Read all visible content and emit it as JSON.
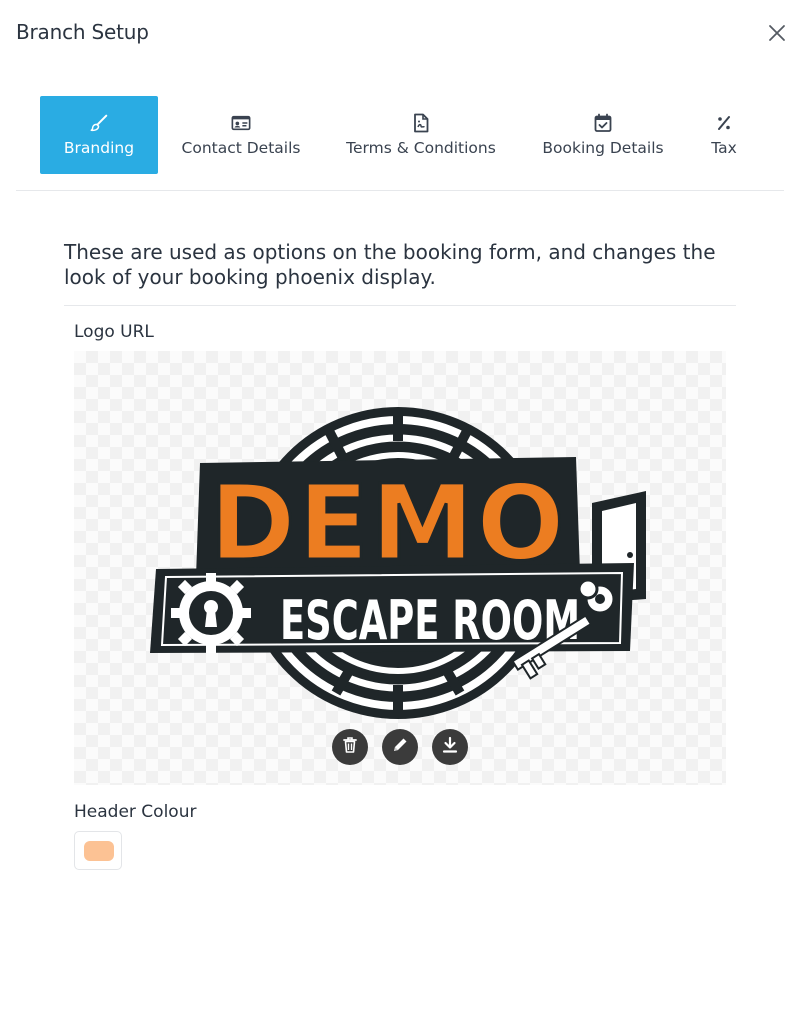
{
  "modal": {
    "title": "Branch Setup",
    "close_icon": "close-icon"
  },
  "tabs": [
    {
      "label": "Branding",
      "icon": "paintbrush-icon",
      "active": true
    },
    {
      "label": "Contact Details",
      "icon": "id-card-icon",
      "active": false
    },
    {
      "label": "Terms & Conditions",
      "icon": "document-icon",
      "active": false
    },
    {
      "label": "Booking Details",
      "icon": "calendar-check-icon",
      "active": false
    },
    {
      "label": "Tax",
      "icon": "percent-icon",
      "active": false
    }
  ],
  "branding": {
    "intro": "These are used as options on the booking form, and changes the look of your booking phoenix display.",
    "logo_label": "Logo URL",
    "logo": {
      "word1": "DEMO",
      "word2": "ESCAPE ROOM"
    },
    "logo_actions": [
      {
        "icon": "trash-icon"
      },
      {
        "icon": "pencil-icon"
      },
      {
        "icon": "download-icon"
      }
    ],
    "header_colour_label": "Header Colour",
    "header_colour": "#fcc294"
  },
  "colors": {
    "accent": "#2aace3",
    "logo_orange": "#ec7d21",
    "logo_dark": "#1f2629"
  }
}
